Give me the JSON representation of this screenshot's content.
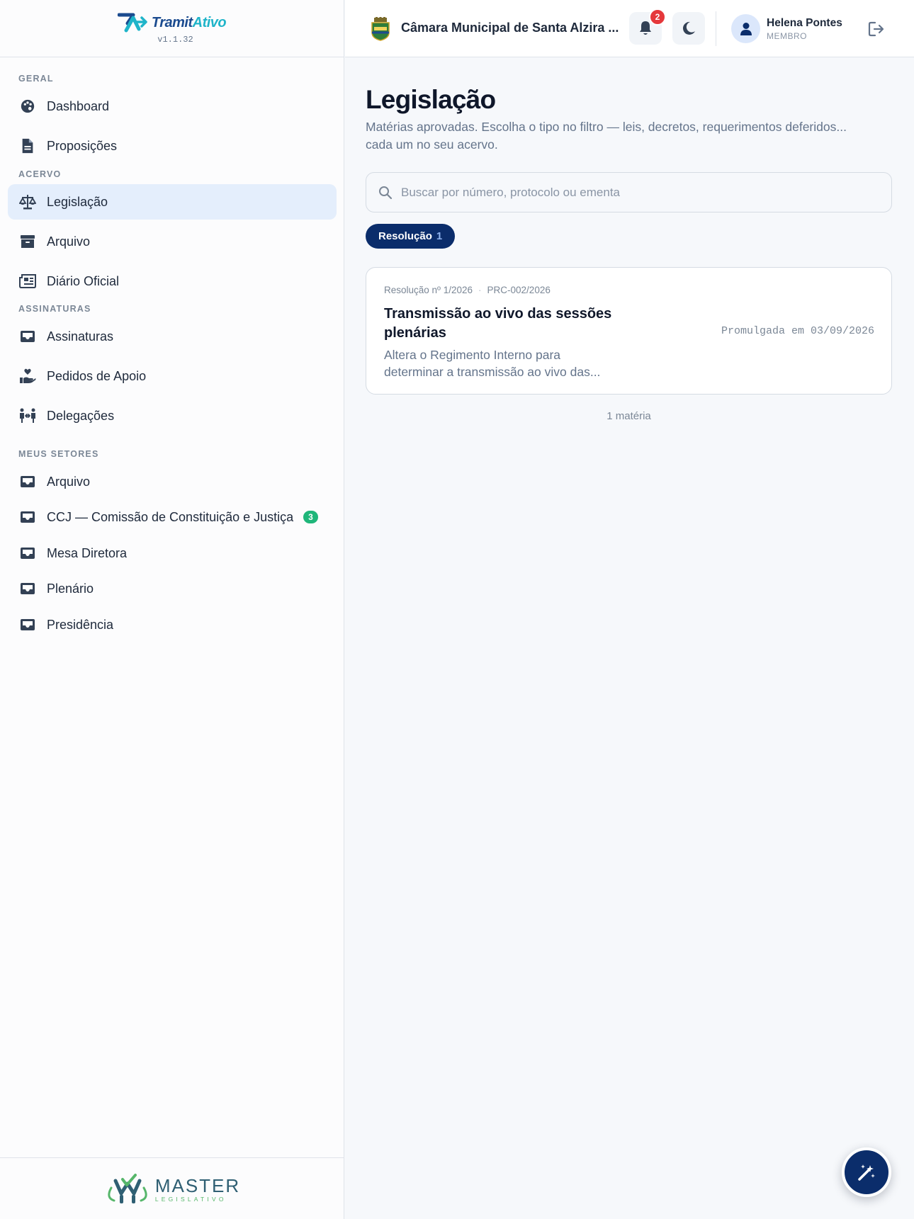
{
  "brand": {
    "name_part1": "Tramit",
    "name_part2": "Ativo",
    "version": "v1.1.32"
  },
  "sidebar": {
    "sections": [
      {
        "title": "GERAL"
      },
      {
        "title": "ACERVO"
      },
      {
        "title": "ASSINATURAS"
      },
      {
        "title": "MEUS SETORES"
      }
    ],
    "items": [
      {
        "label": "Dashboard",
        "icon": "palette-icon"
      },
      {
        "label": "Proposições",
        "icon": "document-icon"
      },
      {
        "label": "Legislação",
        "icon": "scale-icon",
        "active": true
      },
      {
        "label": "Arquivo",
        "icon": "archive-box-icon"
      },
      {
        "label": "Diário Oficial",
        "icon": "newspaper-icon"
      },
      {
        "label": "Assinaturas",
        "icon": "inbox-icon"
      },
      {
        "label": "Pedidos de Apoio",
        "icon": "hand-heart-icon"
      },
      {
        "label": "Delegações",
        "icon": "people-arrows-icon"
      },
      {
        "label": "Arquivo",
        "icon": "inbox-icon"
      },
      {
        "label": "CCJ — Comissão de Constituição e Justiça",
        "icon": "inbox-icon",
        "badge": "3"
      },
      {
        "label": "Mesa Diretora",
        "icon": "inbox-icon"
      },
      {
        "label": "Plenário",
        "icon": "inbox-icon"
      },
      {
        "label": "Presidência",
        "icon": "inbox-icon"
      }
    ],
    "footer": {
      "logo_name": "MASTER",
      "logo_sub": "LEGISLATIVO"
    }
  },
  "topbar": {
    "org_name": "Câmara Municipal de Santa Alzira ...",
    "notifications_count": "2",
    "user_name": "Helena Pontes",
    "user_role": "MEMBRO"
  },
  "main": {
    "title": "Legislação",
    "description": "Matérias aprovadas. Escolha o tipo no filtro — leis, decretos, requerimentos deferidos... cada um no seu acervo.",
    "search_placeholder": "Buscar por número, protocolo ou ementa",
    "filter_chip": {
      "label": "Resolução",
      "count": "1"
    },
    "card": {
      "number": "Resolução nº 1/2026",
      "protocol": "PRC-002/2026",
      "separator": "·",
      "title": "Transmissão ao vivo das sessões plenárias",
      "summary": "Altera o Regimento Interno para determinar a transmissão ao vivo das...",
      "date_label": "Promulgada em 03/09/2026"
    },
    "count_label": "1 matéria"
  },
  "colors": {
    "primary": "#0b2d6b",
    "active_bg": "#e4eefc",
    "badge_green": "#1fb67a",
    "notif_red": "#e5383b"
  }
}
